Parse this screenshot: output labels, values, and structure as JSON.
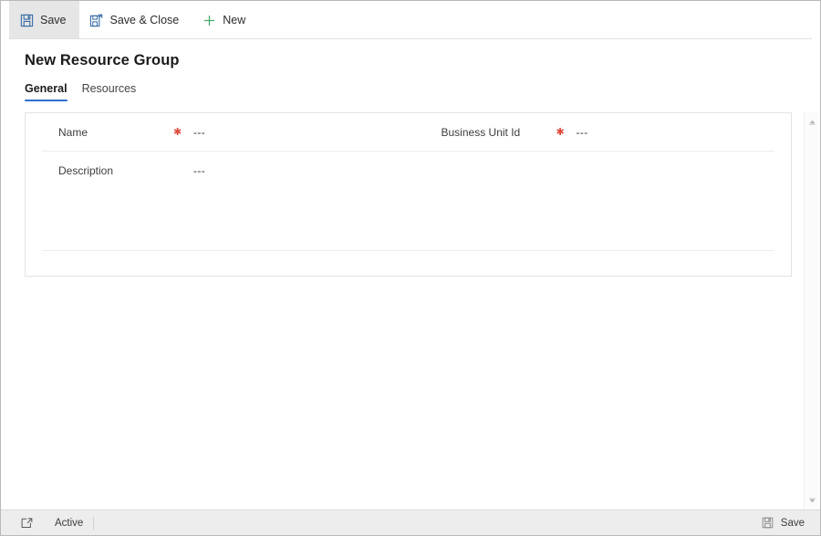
{
  "commandbar": {
    "buttons": [
      {
        "label": "Save",
        "icon": "save-floppy-icon",
        "active": true
      },
      {
        "label": "Save & Close",
        "icon": "save-and-close-icon",
        "active": false
      },
      {
        "label": "New",
        "icon": "plus-icon",
        "active": false
      }
    ]
  },
  "page": {
    "title": "New Resource Group",
    "tabs": [
      {
        "label": "General",
        "selected": true
      },
      {
        "label": "Resources",
        "selected": false
      }
    ]
  },
  "form": {
    "rows": [
      {
        "left": {
          "label": "Name",
          "required": true,
          "value": "---"
        },
        "right": {
          "label": "Business Unit Id",
          "required": true,
          "value": "---"
        }
      },
      {
        "left": {
          "label": "Description",
          "required": false,
          "value": "---"
        },
        "right": {
          "label": "",
          "required": false,
          "value": ""
        }
      }
    ]
  },
  "statusbar": {
    "popout_icon": "open-in-new-window-icon",
    "state": "Active",
    "save_label": "Save",
    "save_icon": "save-floppy-icon"
  },
  "scrollbar": {
    "up_arrow": "chevron-up-icon",
    "down_arrow": "chevron-down-icon"
  },
  "colors": {
    "accent_blue": "#2f6fd0",
    "required_red": "#e04a3c",
    "new_green": "#4aab6e",
    "icon_blue": "#3a6ea5",
    "statusbar_bg": "#ededed"
  }
}
